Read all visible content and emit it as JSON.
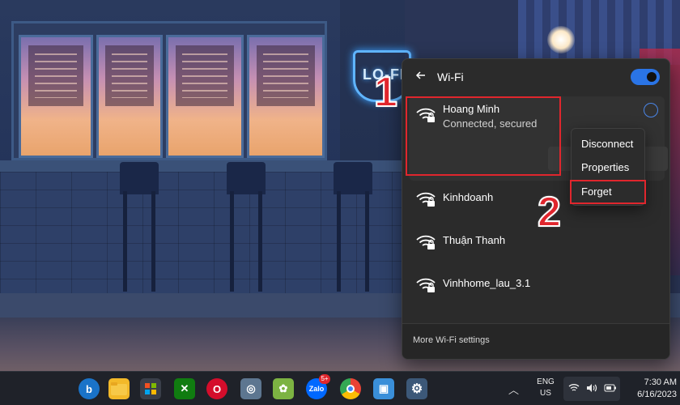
{
  "wifi_panel": {
    "title": "Wi-Fi",
    "toggle_state": "on",
    "connected_network": {
      "name": "Hoang Minh",
      "status": "Connected, secured"
    },
    "networks": [
      {
        "name": "Kinhdoanh"
      },
      {
        "name": "Thuận Thanh"
      },
      {
        "name": "Vinhhome_lau_3.1"
      }
    ],
    "more_settings": "More Wi-Fi settings"
  },
  "context_menu": {
    "items": [
      "Disconnect",
      "Properties",
      "Forget"
    ]
  },
  "annotations": {
    "step1": "1",
    "step2": "2",
    "color": "#e0262d"
  },
  "wallpaper": {
    "neon_sign": "LO-FI"
  },
  "taskbar": {
    "apps": [
      {
        "icon": "bing-icon"
      },
      {
        "icon": "file-explorer-icon"
      },
      {
        "icon": "microsoft-store-icon"
      },
      {
        "icon": "xbox-icon"
      },
      {
        "icon": "opera-icon"
      },
      {
        "icon": "app-icon"
      },
      {
        "icon": "app-icon"
      },
      {
        "icon": "zalo-icon",
        "label": "Zalo",
        "badge": "5+"
      },
      {
        "icon": "chrome-icon"
      },
      {
        "icon": "app-icon"
      },
      {
        "icon": "settings-gear-icon"
      }
    ],
    "language": {
      "line1": "ENG",
      "line2": "US"
    },
    "clock": {
      "time": "7:30 AM",
      "date": "6/16/2023"
    }
  },
  "colors": {
    "accent": "#2a74e6",
    "panel_bg": "#2b2b2b"
  }
}
